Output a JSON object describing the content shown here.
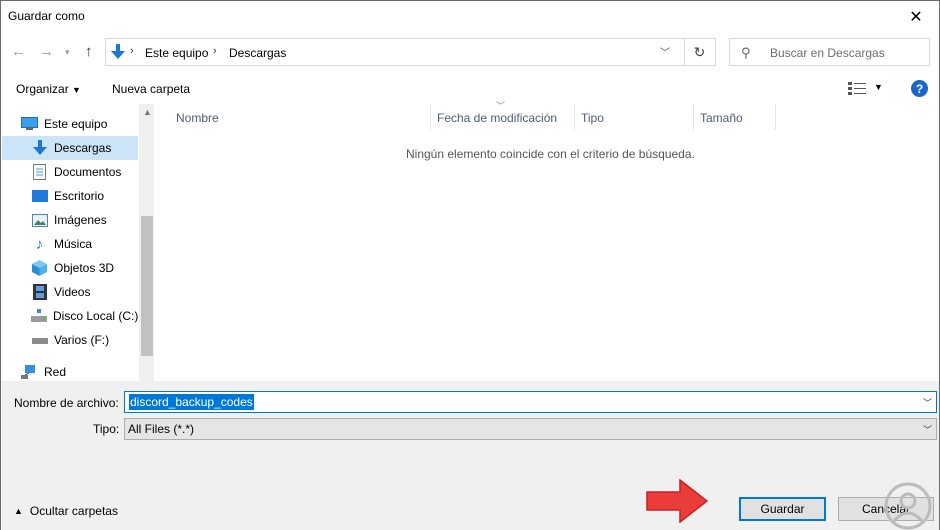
{
  "window": {
    "title": "Guardar como"
  },
  "address": {
    "crumbs": [
      "Este equipo",
      "Descargas"
    ]
  },
  "search": {
    "placeholder": "Buscar en Descargas"
  },
  "toolbar": {
    "organize": "Organizar",
    "new_folder": "Nueva carpeta"
  },
  "nav": {
    "items": [
      {
        "label": "Este equipo",
        "icon": "monitor-icon"
      },
      {
        "label": "Descargas",
        "icon": "download-arrow-icon"
      },
      {
        "label": "Documentos",
        "icon": "document-icon"
      },
      {
        "label": "Escritorio",
        "icon": "desktop-icon"
      },
      {
        "label": "Imágenes",
        "icon": "pictures-icon"
      },
      {
        "label": "Música",
        "icon": "music-note-icon"
      },
      {
        "label": "Objetos 3D",
        "icon": "cube-icon"
      },
      {
        "label": "Videos",
        "icon": "film-icon"
      },
      {
        "label": "Disco Local (C:)",
        "icon": "drive-icon"
      },
      {
        "label": "Varios (F:)",
        "icon": "drive-icon"
      },
      {
        "label": "Red",
        "icon": "network-icon"
      }
    ]
  },
  "filelist": {
    "columns": [
      "Nombre",
      "Fecha de modificación",
      "Tipo",
      "Tamaño"
    ],
    "empty_message": "Ningún elemento coincide con el criterio de búsqueda."
  },
  "form": {
    "filename_label": "Nombre de archivo:",
    "filename_value": "discord_backup_codes",
    "type_label": "Tipo:",
    "type_value": "All Files (*.*)"
  },
  "footer": {
    "hide_folders": "Ocultar carpetas",
    "save": "Guardar",
    "cancel": "Cancelar"
  },
  "colors": {
    "accent": "#0078d7",
    "selection": "#cce4f7",
    "arrow": "#ec3b3b"
  }
}
